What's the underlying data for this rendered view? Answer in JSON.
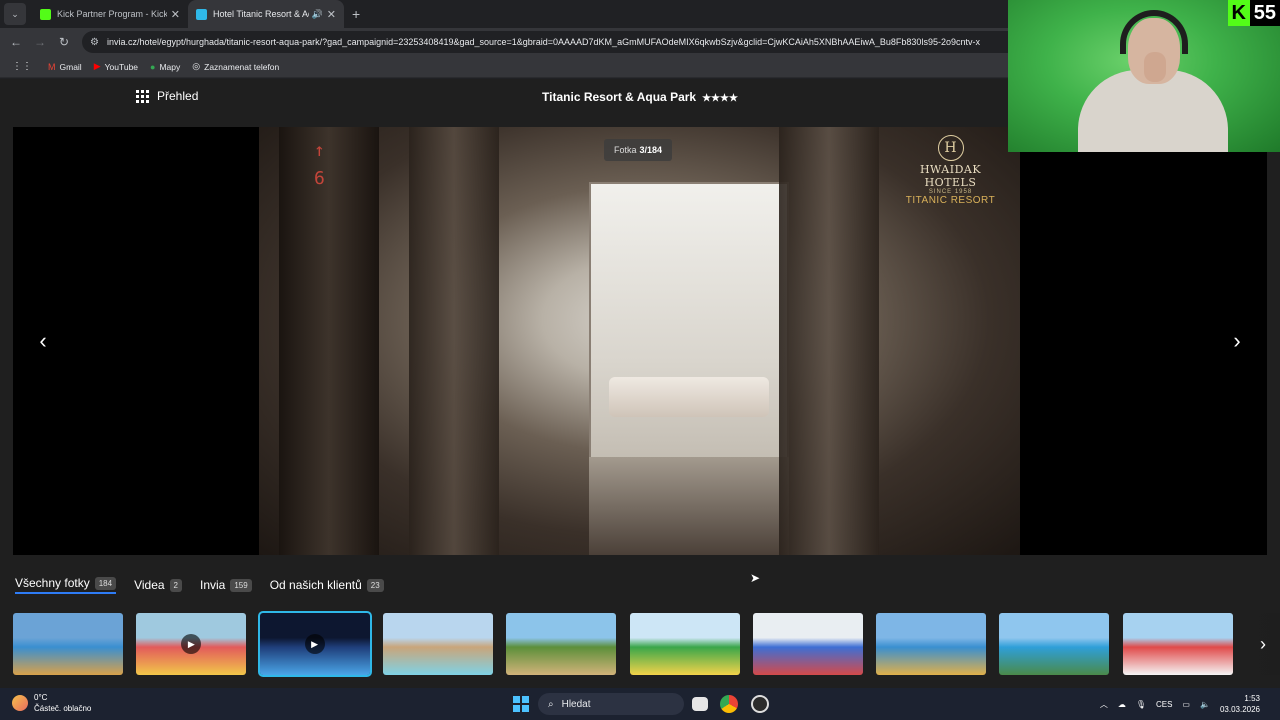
{
  "browser": {
    "tabs": [
      {
        "title": "Kick Partner Program - Kick Da",
        "favicon_color": "#53fc18",
        "active": false
      },
      {
        "title": "Hotel Titanic Resort & Aqua",
        "favicon_color": "#2fb8e8",
        "active": true
      }
    ],
    "url": "invia.cz/hotel/egypt/hurghada/titanic-resort-aqua-park/?gad_campaignid=23253408419&gad_source=1&gbraid=0AAAAD7dKM_aGmMUFAOdeMIX6qkwbSzjv&gclid=CjwKCAiAh5XNBhAAEiwA_Bu8Fb830ls95-2o9cntv-x",
    "bookmarks": [
      "Gmail",
      "YouTube",
      "Mapy",
      "Zaznamenat telefon"
    ]
  },
  "gallery": {
    "overview_label": "Přehled",
    "hotel_name": "Titanic Resort & Aqua Park",
    "stars": "★★★★",
    "counter_prefix": "Fotka",
    "counter_value": "3/184",
    "photo_logo": {
      "brand": "HWAIDAK HOTELS",
      "since": "SINCE 1958",
      "resort": "TITANIC RESORT"
    },
    "tabs": [
      {
        "label": "Všechny fotky",
        "count": "184",
        "active": true
      },
      {
        "label": "Videa",
        "count": "2",
        "active": false
      },
      {
        "label": "Invia",
        "count": "159",
        "active": false
      },
      {
        "label": "Od našich klientů",
        "count": "23",
        "active": false
      }
    ],
    "thumbnails": [
      {
        "colors": [
          "#6ba3d6",
          "#3a8fd0",
          "#d9a14a"
        ],
        "video": false,
        "active": false
      },
      {
        "colors": [
          "#9fc9df",
          "#e25b5b",
          "#f2c74a"
        ],
        "video": true,
        "active": false
      },
      {
        "colors": [
          "#0d1730",
          "#1f3e7a",
          "#4aa5e8"
        ],
        "video": true,
        "active": true
      },
      {
        "colors": [
          "#b9d6ee",
          "#c9a57a",
          "#7fd2e6"
        ],
        "video": false,
        "active": false
      },
      {
        "colors": [
          "#8cc4ea",
          "#5c8f3a",
          "#d2b37a"
        ],
        "video": false,
        "active": false
      },
      {
        "colors": [
          "#cde6f6",
          "#3aa64a",
          "#f3d34a"
        ],
        "video": false,
        "active": false
      },
      {
        "colors": [
          "#e9eef2",
          "#3e6fd4",
          "#d44a4a"
        ],
        "video": false,
        "active": false
      },
      {
        "colors": [
          "#7eb6e6",
          "#3a8fd0",
          "#e0b04a"
        ],
        "video": false,
        "active": false
      },
      {
        "colors": [
          "#8fc6ee",
          "#2f9fd9",
          "#4a8a4a"
        ],
        "video": false,
        "active": false
      },
      {
        "colors": [
          "#a7d2f0",
          "#e04a4a",
          "#f5f5f5"
        ],
        "video": false,
        "active": false
      }
    ]
  },
  "stream": {
    "viewer_count": "55"
  },
  "taskbar": {
    "weather_temp": "0°C",
    "weather_desc": "Částeč. oblačno",
    "search_placeholder": "Hledat",
    "language": "CES",
    "time": "1:53",
    "date": "03.03.2026"
  }
}
